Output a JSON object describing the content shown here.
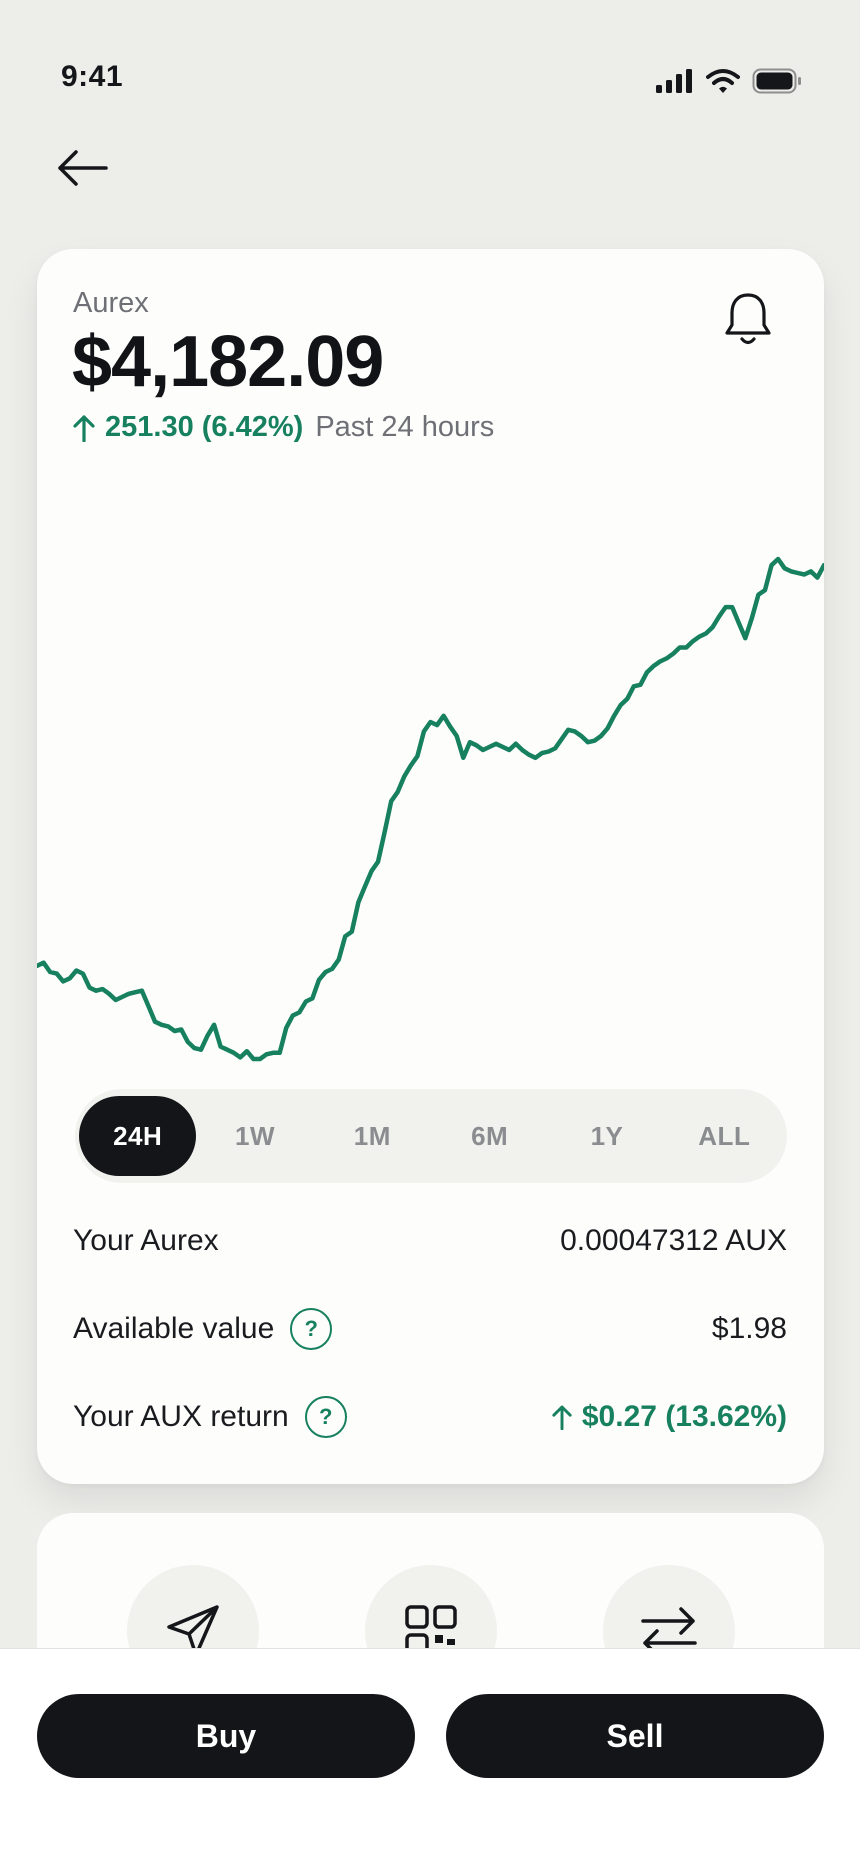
{
  "status_bar": {
    "time": "9:41"
  },
  "asset": {
    "name": "Aurex",
    "price": "$4,182.09",
    "change": "251.30 (6.42%)",
    "change_period": "Past 24 hours"
  },
  "chart_data": {
    "type": "line",
    "title": "",
    "xlabel": "",
    "ylabel": "",
    "color": "#17805f",
    "x": [
      0,
      1,
      2,
      3,
      4,
      5,
      6,
      7,
      8,
      9,
      10,
      11,
      12,
      13,
      14,
      15,
      16,
      17,
      18,
      19,
      20,
      21,
      22,
      23,
      24,
      25,
      26,
      27,
      28,
      29,
      30,
      31,
      32,
      33,
      34,
      35,
      36,
      37,
      38,
      39,
      40,
      41,
      42,
      43,
      44,
      45,
      46,
      47,
      48,
      49,
      50,
      51,
      52,
      53,
      54,
      55,
      56,
      57,
      58,
      59,
      60,
      61,
      62,
      63,
      64,
      65,
      66,
      67,
      68,
      69,
      70,
      71,
      72,
      73,
      74,
      75,
      76,
      77,
      78,
      79,
      80,
      81,
      82,
      83,
      84,
      85,
      86,
      87,
      88,
      89,
      90,
      91,
      92,
      93,
      94,
      95,
      96,
      97,
      98,
      99,
      100,
      101,
      102,
      103,
      104,
      105,
      106,
      107,
      108,
      109,
      110,
      111,
      112,
      113,
      114,
      115,
      116,
      117,
      118,
      119,
      120
    ],
    "values": [
      3962,
      3964,
      3958,
      3957,
      3952,
      3954,
      3959,
      3957,
      3948,
      3946,
      3947,
      3944,
      3940,
      3942,
      3944,
      3945,
      3946,
      3936,
      3926,
      3924,
      3923,
      3920,
      3921,
      3913,
      3909,
      3908,
      3917,
      3924,
      3910,
      3908,
      3906,
      3903,
      3907,
      3902,
      3902,
      3905,
      3906,
      3906,
      3922,
      3930,
      3932,
      3939,
      3941,
      3953,
      3958,
      3960,
      3966,
      3981,
      3984,
      4003,
      4013,
      4023,
      4029,
      4048,
      4068,
      4074,
      4084,
      4091,
      4097,
      4113,
      4119,
      4117,
      4123,
      4116,
      4110,
      4096,
      4106,
      4104,
      4101,
      4103,
      4105,
      4103,
      4101,
      4105,
      4101,
      4098,
      4096,
      4099,
      4100,
      4102,
      4108,
      4114,
      4113,
      4110,
      4106,
      4107,
      4110,
      4115,
      4123,
      4130,
      4134,
      4142,
      4143,
      4151,
      4155,
      4158,
      4160,
      4163,
      4167,
      4167,
      4171,
      4174,
      4176,
      4180,
      4187,
      4193,
      4193,
      4183,
      4173,
      4186,
      4201,
      4204,
      4220,
      4224,
      4218,
      4216,
      4215,
      4214,
      4216,
      4212,
      4220
    ]
  },
  "ranges": [
    "24H",
    "1W",
    "1M",
    "6M",
    "1Y",
    "ALL"
  ],
  "active_range": "24H",
  "holdings": [
    {
      "label": "Your Aurex",
      "value": "0.00047312 AUX",
      "help": false,
      "gain": false
    },
    {
      "label": "Available value",
      "value": "$1.98",
      "help": true,
      "gain": false
    },
    {
      "label": "Your AUX return",
      "value": "$0.27 (13.62%)",
      "help": true,
      "gain": true
    }
  ],
  "help_glyph": "?",
  "actions": [
    "send-icon",
    "qr-code-icon",
    "swap-icon"
  ],
  "buttons": {
    "buy": "Buy",
    "sell": "Sell"
  },
  "colors": {
    "accent": "#17805f",
    "primary": "#141518",
    "background": "#ededea"
  }
}
